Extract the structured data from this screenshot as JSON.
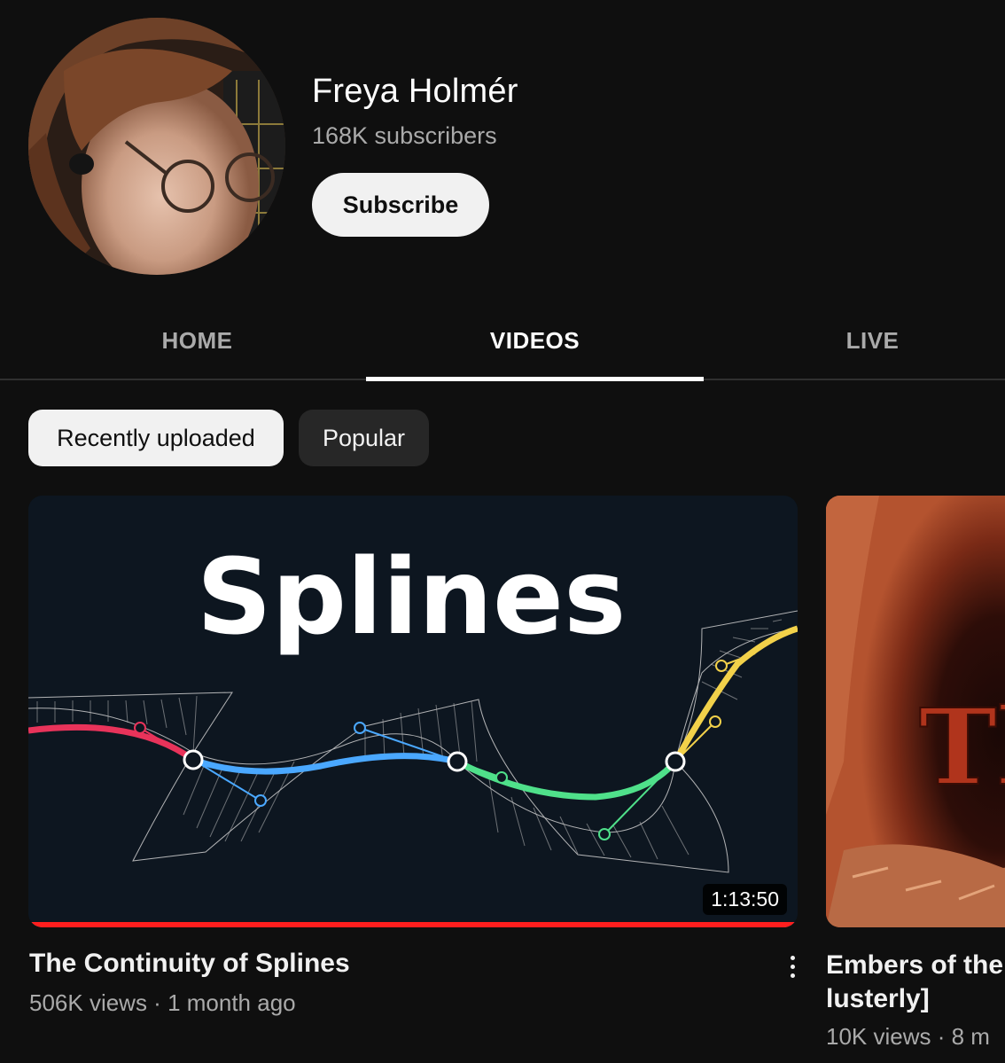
{
  "channel": {
    "name": "Freya Holmér",
    "subscribers": "168K subscribers",
    "subscribe_label": "Subscribe"
  },
  "tabs": [
    {
      "label": "HOME",
      "active": false
    },
    {
      "label": "VIDEOS",
      "active": true
    },
    {
      "label": "LIVE",
      "active": false
    }
  ],
  "chips": [
    {
      "label": "Recently uploaded",
      "selected": true
    },
    {
      "label": "Popular",
      "selected": false
    }
  ],
  "videos": [
    {
      "thumbnail_text": "Splines",
      "duration": "1:13:50",
      "watched_fraction": 1.0,
      "title": "The Continuity of Splines",
      "meta": "506K views · 1 month ago"
    },
    {
      "thumbnail_text": "Th",
      "title_line1": "Embers of the",
      "title_line2": "lusterly]",
      "meta": "10K views · 8 m"
    }
  ],
  "colors": {
    "background": "#0f0f0f",
    "progress": "#ff1e1e",
    "spline_red": "#e8335a",
    "spline_blue": "#4aa8ff",
    "spline_green": "#4fe08a",
    "spline_yellow": "#f2d14a"
  }
}
